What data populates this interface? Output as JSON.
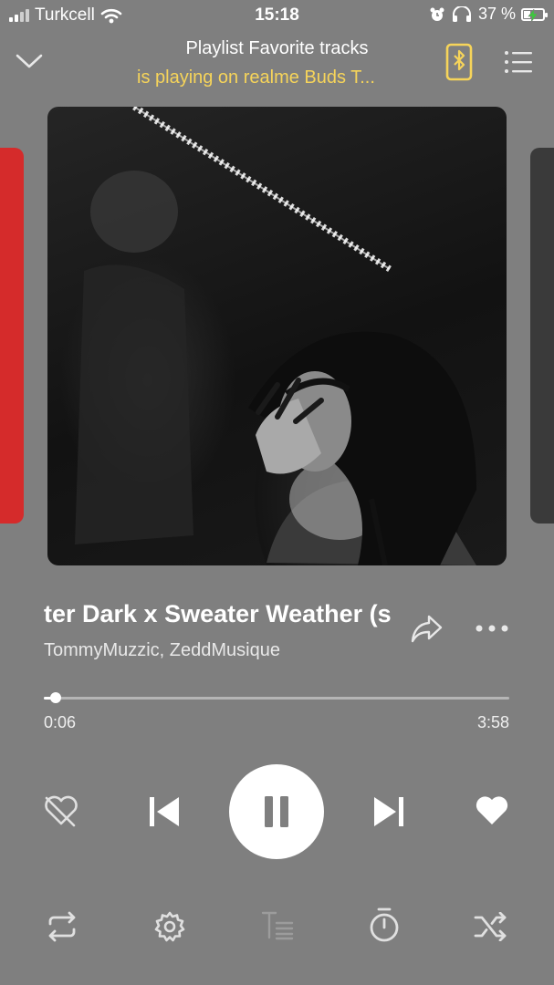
{
  "status_bar": {
    "carrier": "Turkcell",
    "time": "15:18",
    "battery": "37 %",
    "battery_level": 0.37
  },
  "header": {
    "title": "Playlist Favorite tracks",
    "subtitle": "is playing on realme Buds T..."
  },
  "track": {
    "title": "ter Dark x Sweater Weather (s",
    "artist": "TommyMuzzic, ZeddMusique"
  },
  "progress": {
    "elapsed": "0:06",
    "total": "3:58",
    "fraction": 0.025
  },
  "colors": {
    "background": "#7f7f7f",
    "accent_yellow": "#f6d45a",
    "left_card": "#d52b2b"
  },
  "icons": {
    "header_left": "chevron-down-icon",
    "header_device": "bluetooth-phone-icon",
    "header_menu": "queue-list-icon",
    "share": "share-icon",
    "more": "more-dots-icon",
    "dislike": "dislike-heart-icon",
    "previous": "previous-track-icon",
    "pause": "pause-icon",
    "next": "next-track-icon",
    "like": "heart-icon",
    "repeat": "repeat-icon",
    "settings": "gear-icon",
    "lyrics": "lyrics-icon",
    "timer": "timer-icon",
    "shuffle": "shuffle-icon"
  }
}
